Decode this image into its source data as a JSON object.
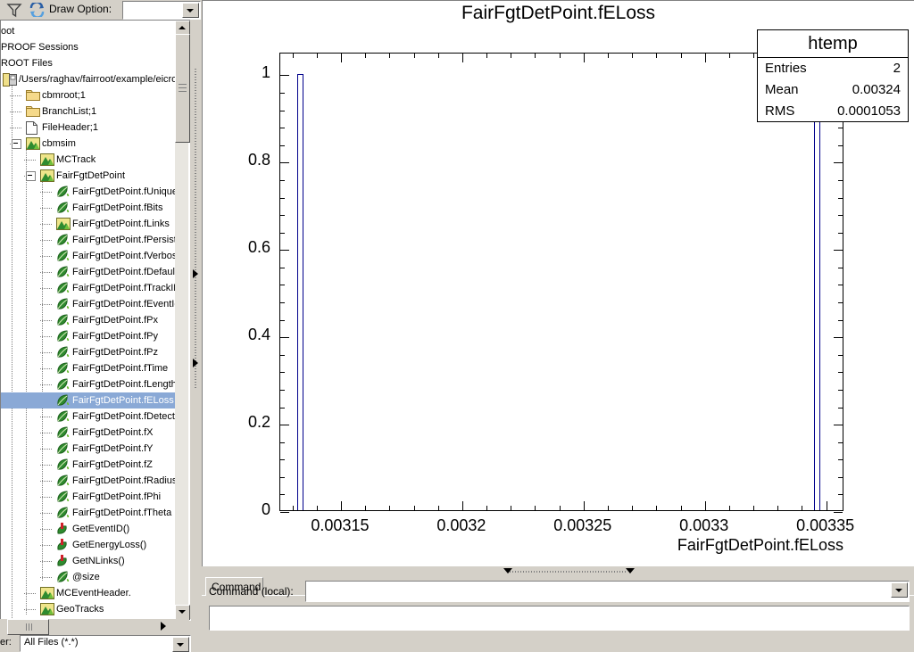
{
  "toolbar": {
    "filter_icon": "funnel-icon",
    "refresh_icon": "refresh-icon",
    "draw_option_label": "Draw Option:",
    "draw_option_value": "",
    "draw_option_placeholder": ""
  },
  "tree": {
    "items": [
      {
        "label": "oot",
        "indent": 0,
        "icon": "none",
        "selected": false,
        "clipped": true
      },
      {
        "label": "PROOF Sessions",
        "indent": 0,
        "icon": "none",
        "selected": false,
        "clipped": true
      },
      {
        "label": "ROOT Files",
        "indent": 0,
        "icon": "none",
        "selected": false,
        "clipped": true
      },
      {
        "label": "/Users/raghav/fairroot/example/eicroot/s",
        "indent": 0,
        "icon": "disk-icon",
        "selected": false,
        "clipped": true
      },
      {
        "label": "cbmroot;1",
        "indent": 1,
        "icon": "folder-icon",
        "selected": false
      },
      {
        "label": "BranchList;1",
        "indent": 1,
        "icon": "folder-icon",
        "selected": false
      },
      {
        "label": "FileHeader;1",
        "indent": 1,
        "icon": "document-icon",
        "selected": false
      },
      {
        "label": "cbmsim",
        "indent": 1,
        "icon": "tree-icon",
        "selected": false,
        "expander": true
      },
      {
        "label": "MCTrack",
        "indent": 2,
        "icon": "tree-icon",
        "selected": false
      },
      {
        "label": "FairFgtDetPoint",
        "indent": 2,
        "icon": "tree-icon",
        "selected": false,
        "expander": true
      },
      {
        "label": "FairFgtDetPoint.fUniqueID",
        "indent": 3,
        "icon": "leaf-icon",
        "selected": false
      },
      {
        "label": "FairFgtDetPoint.fBits",
        "indent": 3,
        "icon": "leaf-icon",
        "selected": false
      },
      {
        "label": "FairFgtDetPoint.fLinks",
        "indent": 3,
        "icon": "tree-icon",
        "selected": false
      },
      {
        "label": "FairFgtDetPoint.fPersistanc",
        "indent": 3,
        "icon": "leaf-icon",
        "selected": false
      },
      {
        "label": "FairFgtDetPoint.fVerbose",
        "indent": 3,
        "icon": "leaf-icon",
        "selected": false
      },
      {
        "label": "FairFgtDetPoint.fDefaultTyp",
        "indent": 3,
        "icon": "leaf-icon",
        "selected": false
      },
      {
        "label": "FairFgtDetPoint.fTrackID",
        "indent": 3,
        "icon": "leaf-icon",
        "selected": false
      },
      {
        "label": "FairFgtDetPoint.fEventId",
        "indent": 3,
        "icon": "leaf-icon",
        "selected": false
      },
      {
        "label": "FairFgtDetPoint.fPx",
        "indent": 3,
        "icon": "leaf-icon",
        "selected": false
      },
      {
        "label": "FairFgtDetPoint.fPy",
        "indent": 3,
        "icon": "leaf-icon",
        "selected": false
      },
      {
        "label": "FairFgtDetPoint.fPz",
        "indent": 3,
        "icon": "leaf-icon",
        "selected": false
      },
      {
        "label": "FairFgtDetPoint.fTime",
        "indent": 3,
        "icon": "leaf-icon",
        "selected": false
      },
      {
        "label": "FairFgtDetPoint.fLength",
        "indent": 3,
        "icon": "leaf-icon",
        "selected": false
      },
      {
        "label": "FairFgtDetPoint.fELoss",
        "indent": 3,
        "icon": "leaf-icon",
        "selected": true
      },
      {
        "label": "FairFgtDetPoint.fDetectorI",
        "indent": 3,
        "icon": "leaf-icon",
        "selected": false
      },
      {
        "label": "FairFgtDetPoint.fX",
        "indent": 3,
        "icon": "leaf-icon",
        "selected": false
      },
      {
        "label": "FairFgtDetPoint.fY",
        "indent": 3,
        "icon": "leaf-icon",
        "selected": false
      },
      {
        "label": "FairFgtDetPoint.fZ",
        "indent": 3,
        "icon": "leaf-icon",
        "selected": false
      },
      {
        "label": "FairFgtDetPoint.fRadius",
        "indent": 3,
        "icon": "leaf-icon",
        "selected": false
      },
      {
        "label": "FairFgtDetPoint.fPhi",
        "indent": 3,
        "icon": "leaf-icon",
        "selected": false
      },
      {
        "label": "FairFgtDetPoint.fTheta",
        "indent": 3,
        "icon": "leaf-icon",
        "selected": false
      },
      {
        "label": "GetEventID()",
        "indent": 3,
        "icon": "method-icon",
        "selected": false
      },
      {
        "label": "GetEnergyLoss()",
        "indent": 3,
        "icon": "method-icon",
        "selected": false
      },
      {
        "label": "GetNLinks()",
        "indent": 3,
        "icon": "method-icon",
        "selected": false
      },
      {
        "label": "@size",
        "indent": 3,
        "icon": "leaf-icon",
        "selected": false
      },
      {
        "label": "MCEventHeader.",
        "indent": 2,
        "icon": "tree-icon",
        "selected": false
      },
      {
        "label": "GeoTracks",
        "indent": 2,
        "icon": "tree-icon",
        "selected": false
      }
    ]
  },
  "filter": {
    "label": "er:",
    "value": "All Files (*.*)"
  },
  "chart_data": {
    "type": "bar",
    "title": "FairFgtDetPoint.fELoss",
    "xlabel": "FairFgtDetPoint.fELoss",
    "ylabel": "",
    "xlim": [
      0.003125,
      0.0033575
    ],
    "ylim": [
      0,
      1.05
    ],
    "x_ticks": [
      "0.00315",
      "0.0032",
      "0.00325",
      "0.0033",
      "0.00335"
    ],
    "x_tick_values": [
      0.00315,
      0.0032,
      0.00325,
      0.0033,
      0.00335
    ],
    "y_ticks": [
      "0",
      "0.2",
      "0.4",
      "0.6",
      "0.8",
      "1"
    ],
    "y_tick_values": [
      0,
      0.2,
      0.4,
      0.6,
      0.8,
      1
    ],
    "grid": false,
    "legend": "none",
    "bar_color": "#00008b",
    "bars": [
      {
        "x": 0.0031335,
        "value": 1
      },
      {
        "x": 0.0033465,
        "value": 1
      }
    ]
  },
  "stats": {
    "name": "htemp",
    "rows": [
      {
        "label": "Entries",
        "value": "2"
      },
      {
        "label": "Mean",
        "value": "0.00324"
      },
      {
        "label": "RMS",
        "value": "0.0001053"
      }
    ]
  },
  "command": {
    "tab_label": "Command",
    "input_label": "Command (local):",
    "input_value": "",
    "output_value": ""
  }
}
